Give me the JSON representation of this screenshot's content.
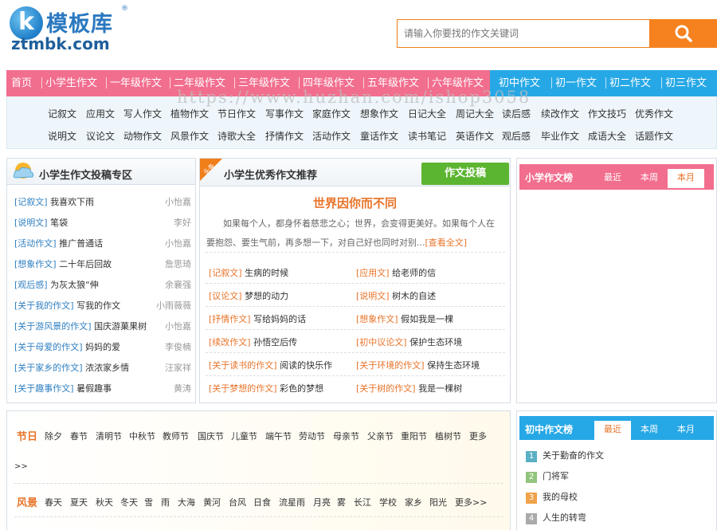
{
  "header": {
    "logo_icon_letter": "k",
    "logo_text_cn": "模板库",
    "logo_reg": "®",
    "logo_text_en": "ztmbk.com",
    "search_placeholder": "请输入你要找的作文关键词"
  },
  "nav": {
    "items": [
      "首页",
      "小学生作文",
      "一年级作文",
      "二年级作文",
      "三年级作文",
      "四年级作文",
      "五年级作文",
      "六年级作文",
      "初中作文",
      "初一作文",
      "初二作文",
      "初三作文"
    ],
    "sub_row1": [
      "记叙文",
      "应用文",
      "写人作文",
      "植物作文",
      "节日作文",
      "写事作文",
      "家庭作文",
      "想象作文",
      "日记大全",
      "周记大全",
      "读后感",
      "续改作文",
      "作文技巧",
      "优秀作文"
    ],
    "sub_row2": [
      "说明文",
      "议论文",
      "动物作文",
      "风景作文",
      "诗歌大全",
      "抒情作文",
      "活动作文",
      "童话作文",
      "读书笔记",
      "英语作文",
      "观后感",
      "毕业作文",
      "成语大全",
      "话题作文"
    ]
  },
  "watermark": "https://www.huzhan.com/ishop3058",
  "submit_panel": {
    "title": "小学生作文投稿专区",
    "rows": [
      {
        "cat": "[记叙文]",
        "title": "我喜欢下雨",
        "author": "小怡嘉"
      },
      {
        "cat": "[说明文]",
        "title": "笔袋",
        "author": "李好"
      },
      {
        "cat": "[活动作文]",
        "title": "推广普通话",
        "author": "小怡嘉"
      },
      {
        "cat": "[想象作文]",
        "title": "二十年后回故",
        "author": "詹思琦"
      },
      {
        "cat": "[观后感]",
        "title": "为灰太狼“伸",
        "author": "余襄强"
      },
      {
        "cat": "[关于我的作文]",
        "title": "写我的作文",
        "author": "小雨薇薇"
      },
      {
        "cat": "[关于游风景的作文]",
        "title": "国庆游菓果树",
        "author": "小怡嘉"
      },
      {
        "cat": "[关于母爱的作文]",
        "title": "妈妈的爱",
        "author": "李俊楠"
      },
      {
        "cat": "[关于家乡的作文]",
        "title": "浓浓家乡情",
        "author": "汪家祥"
      },
      {
        "cat": "[关于趣事作文]",
        "title": "暑假趣事",
        "author": "黄涛"
      }
    ]
  },
  "recommend_panel": {
    "ribbon": "头条",
    "title": "小学生优秀作文推荐",
    "submit_button": "作文投稿",
    "headline": "世界因你而不同",
    "summary_line1": "如果每个人，都身怀着慈悲之心；世界，会变得更美好。如果每个人在",
    "summary_line2": "要抱怨、要生气前，再多想一下，对自己好也同时对别...",
    "read_more": "[查看全文]",
    "items": [
      {
        "cat": "[记叙文]",
        "title": "生病的时候"
      },
      {
        "cat": "[应用文]",
        "title": "给老师的信"
      },
      {
        "cat": "[议论文]",
        "title": "梦想的动力"
      },
      {
        "cat": "[说明文]",
        "title": "树木的自述"
      },
      {
        "cat": "[抒情作文]",
        "title": "写给妈妈的话"
      },
      {
        "cat": "[想象作文]",
        "title": "假如我是一棵"
      },
      {
        "cat": "[续改作文]",
        "title": "孙悟空后传"
      },
      {
        "cat": "[初中议论文]",
        "title": "保护生态环境"
      },
      {
        "cat": "[关于读书的作文]",
        "title": "阅读的快乐作"
      },
      {
        "cat": "[关于环境的作文]",
        "title": "保持生态环境"
      },
      {
        "cat": "[关于梦想的作文]",
        "title": "彩色的梦想"
      },
      {
        "cat": "[关于树的作文]",
        "title": "我是一棵树"
      }
    ]
  },
  "primary_rank": {
    "title": "小学作文榜",
    "tabs": [
      "最近",
      "本周",
      "本月"
    ],
    "active_tab": 2
  },
  "tags_panel": {
    "festival_label": "节日",
    "festival": [
      "除夕",
      "春节",
      "清明节",
      "中秋节",
      "教师节",
      "国庆节",
      "儿童节",
      "端午节",
      "劳动节",
      "母亲节",
      "父亲节",
      "重阳节",
      "植树节",
      "更多"
    ],
    "festival_more_tail": ">>",
    "scenery_label": "风景",
    "scenery": [
      "春天",
      "夏天",
      "秋天",
      "冬天",
      "雪",
      "雨",
      "大海",
      "黄河",
      "台风",
      "日食",
      "流星雨",
      "月亮",
      "雾",
      "长江",
      "学校",
      "家乡",
      "阳光",
      "更多>>"
    ]
  },
  "junior_rank": {
    "title": "初中作文榜",
    "tabs": [
      "最近",
      "本周",
      "本月"
    ],
    "active_tab": 0,
    "items": [
      {
        "num": "1",
        "title": "关于勤奋的作文",
        "color": "#5bb0c4"
      },
      {
        "num": "2",
        "title": "门将军",
        "color": "#93c47d"
      },
      {
        "num": "3",
        "title": "我的母校",
        "color": "#f0a24a"
      },
      {
        "num": "4",
        "title": "人生的转弯",
        "color": "#aaaaaa"
      }
    ]
  },
  "colors": {
    "nav_pink": "#f26e8e",
    "nav_blue": "#27a8e6",
    "search_orange": "#f5821f",
    "green_button": "#5cb531",
    "accent_orange": "#e8742a",
    "link_blue": "#2f7fc1"
  }
}
